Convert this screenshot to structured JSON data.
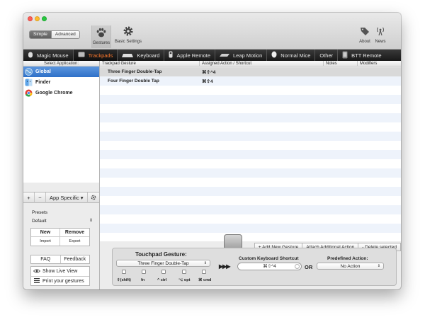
{
  "toolbar": {
    "mode_simple": "Simple",
    "mode_advanced": "Advanced",
    "gestures_label": "Gestures",
    "basic_settings_label": "Basic Settings",
    "about_label": "About",
    "news_label": "News"
  },
  "device_tabs": [
    {
      "label": "Magic Mouse",
      "icon": "mouse-icon"
    },
    {
      "label": "Trackpads",
      "icon": "trackpad-icon",
      "active": true
    },
    {
      "label": "Keyboard",
      "icon": "keyboard-icon"
    },
    {
      "label": "Apple Remote",
      "icon": "remote-icon"
    },
    {
      "label": "Leap Motion",
      "icon": "leap-icon"
    },
    {
      "label": "Normal Mice",
      "icon": "normal-mouse-icon"
    },
    {
      "label": "Other",
      "icon": ""
    },
    {
      "label": "BTT Remote",
      "icon": "phone-icon"
    }
  ],
  "sidebar": {
    "header": "Select Application:",
    "apps": [
      {
        "label": "Global",
        "icon": "globe-icon",
        "selected": true
      },
      {
        "label": "Finder",
        "icon": "finder-icon"
      },
      {
        "label": "Google Chrome",
        "icon": "chrome-icon"
      }
    ],
    "add": "+",
    "remove": "−",
    "app_specific": "App Specific ▾",
    "presets_label": "Presets",
    "preset_value": "Default",
    "preset_new": "New",
    "preset_remove": "Remove",
    "preset_import": "Import",
    "preset_export": "Export",
    "faq": "FAQ",
    "feedback": "Feedback",
    "show_live_view": "Show Live View",
    "print_gestures": "Print your gestures"
  },
  "table": {
    "columns": [
      "Trackpad Gesture",
      "Assigned Action / Shortcut",
      "Notes",
      "Modifiers"
    ],
    "rows": [
      {
        "gesture": "Three Finger Double-Tap",
        "action": "⌘⇧^4",
        "notes": "",
        "modifiers": ""
      },
      {
        "gesture": "Four Finger Double Tap",
        "action": "⌘⇧4",
        "notes": "",
        "modifiers": ""
      }
    ]
  },
  "actions": {
    "add_gesture": "+ Add New Gesture",
    "attach_action": "Attach Additional Action",
    "delete_selected": "- Delete selected"
  },
  "editor": {
    "title": "Touchpad Gesture:",
    "gesture_value": "Three Finger Double-Tap",
    "mods": [
      "⇧(shift)",
      "fn",
      "^ ctrl",
      "⌥ opt",
      "⌘ cmd"
    ],
    "arrows": "▶▶▶",
    "shortcut_label": "Custom Keyboard Shortcut",
    "shortcut_value": "⌘⇧^4",
    "or_label": "OR",
    "predefined_label": "Predefined Action:",
    "predefined_value": "No Action"
  }
}
